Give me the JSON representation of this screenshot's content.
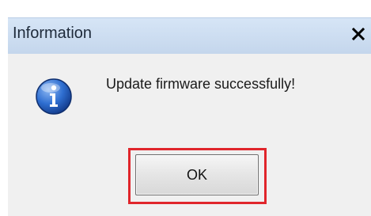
{
  "dialog": {
    "title": "Information",
    "close_label": "×",
    "message": "Update firmware successfully!",
    "icon": "info-icon",
    "ok_label": "OK",
    "highlight_color": "#e0252b"
  }
}
